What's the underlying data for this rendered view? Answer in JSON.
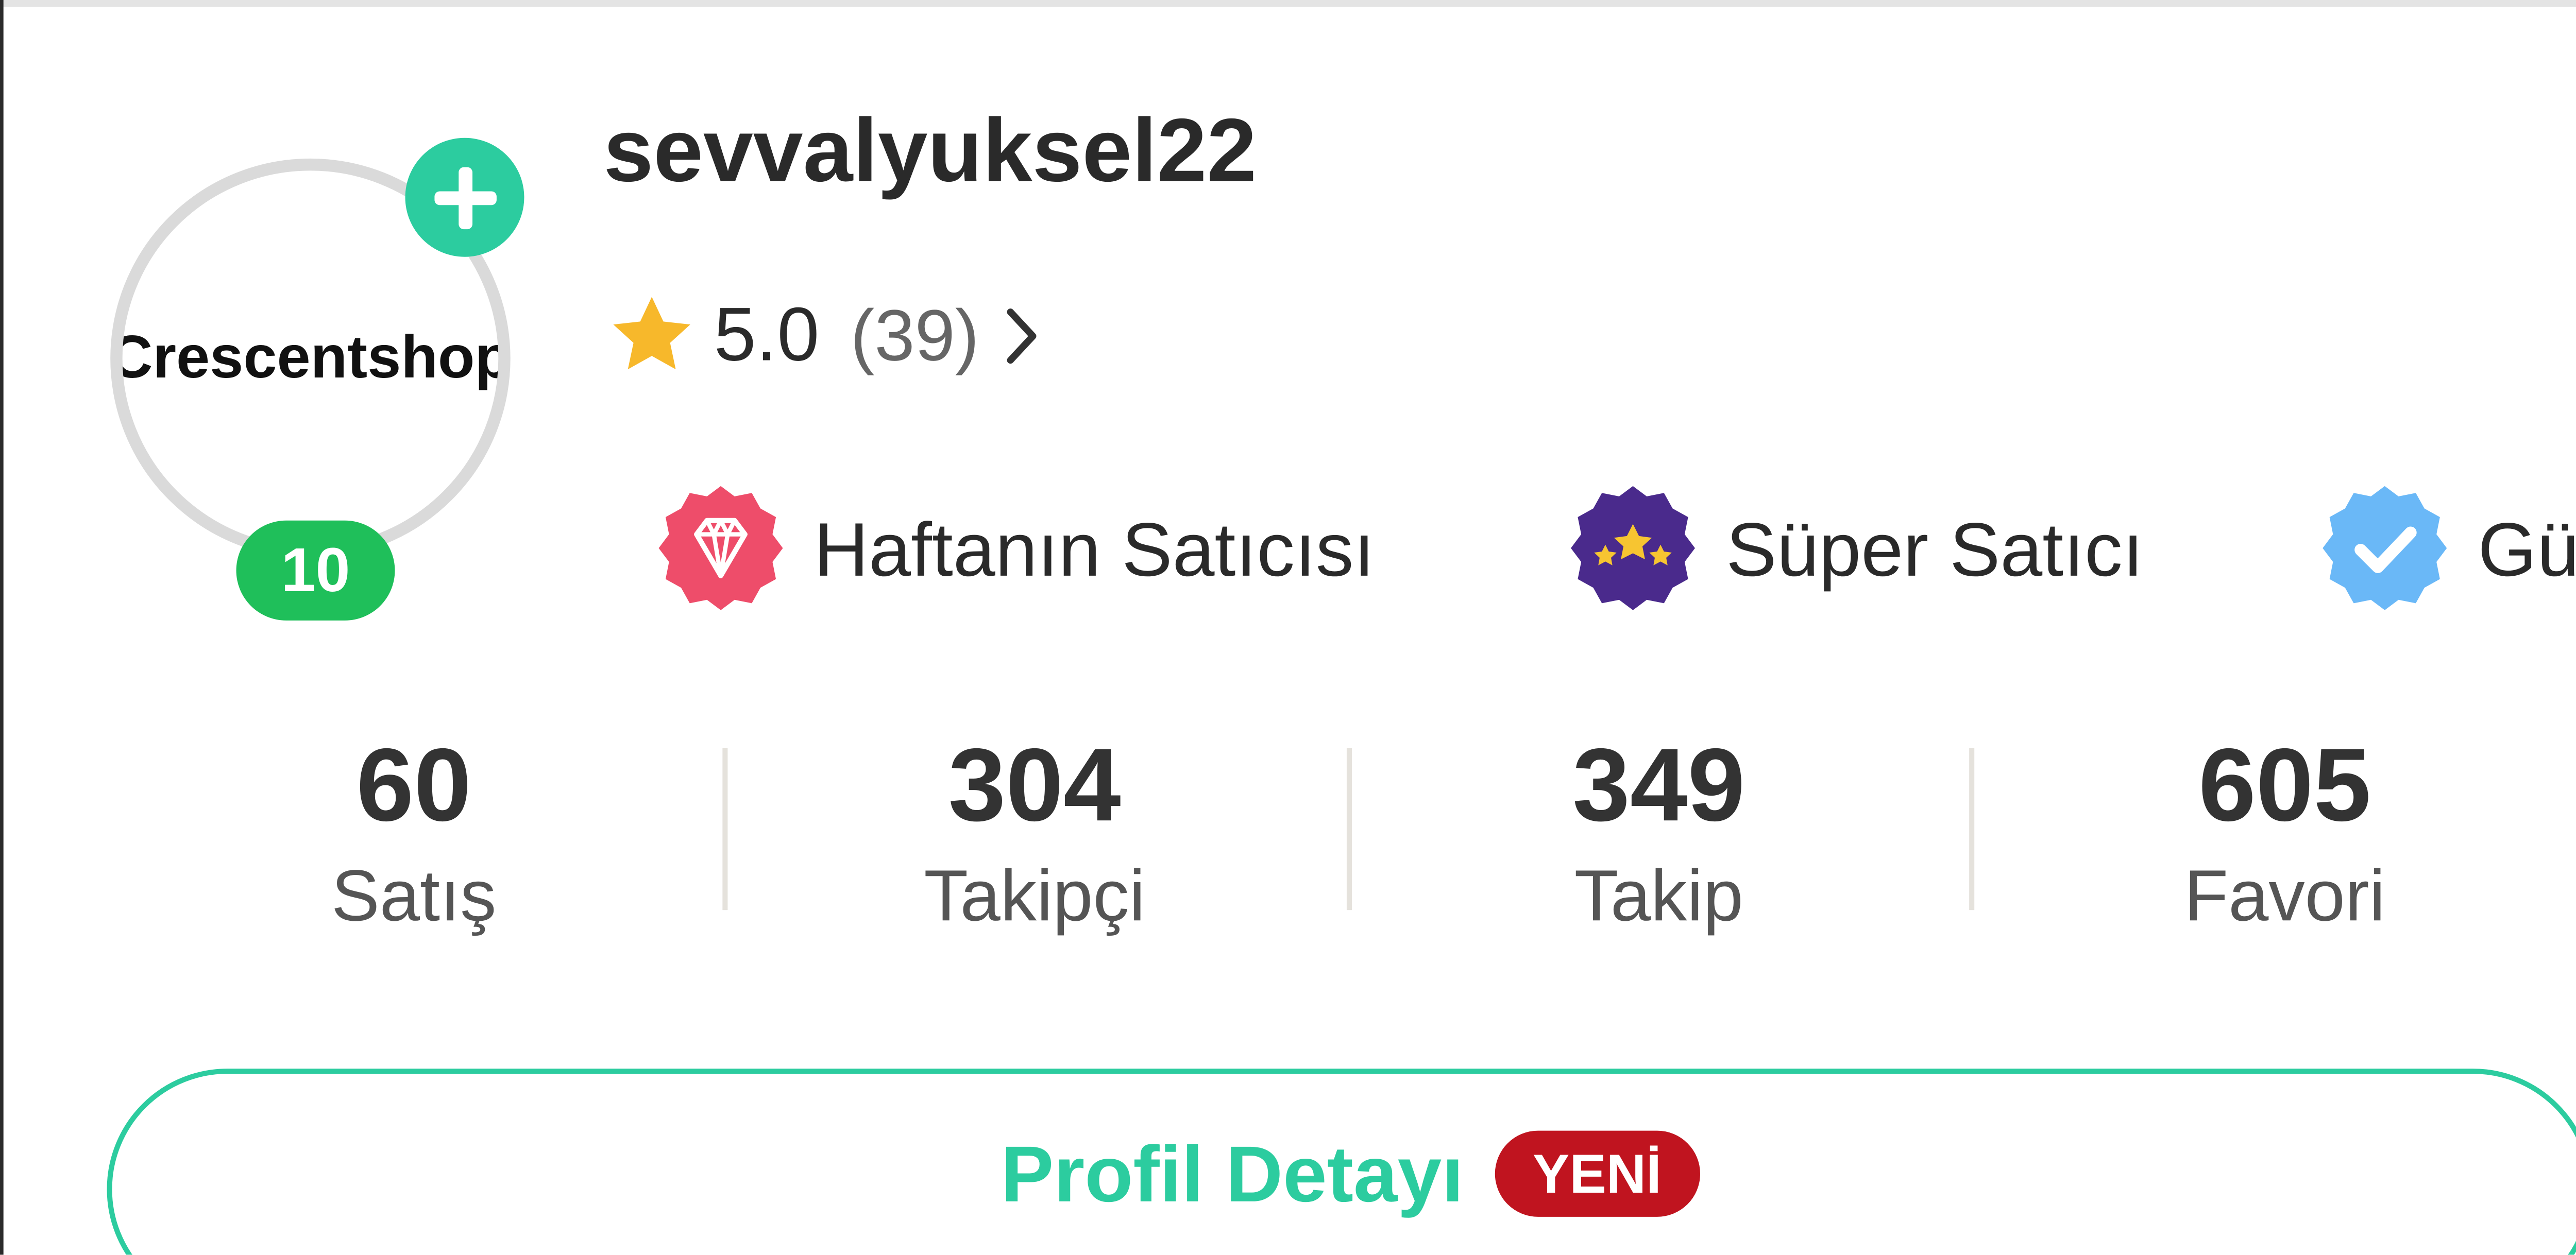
{
  "shop": {
    "avatar_text": "Crescentshop",
    "level": "10",
    "username": "sevvalyuksel22"
  },
  "rating": {
    "score": "5.0",
    "count": "(39)"
  },
  "badges": [
    {
      "label": "Haftanın Satıcısı",
      "icon": "diamond-badge-icon",
      "color": "#ee4d6a"
    },
    {
      "label": "Süper Satıcı",
      "icon": "stars-badge-icon",
      "color": "#4a2a8c"
    },
    {
      "label": "Güven",
      "icon": "verified-badge-icon",
      "color": "#6ab8f7"
    }
  ],
  "stats": [
    {
      "value": "60",
      "label": "Satış"
    },
    {
      "value": "304",
      "label": "Takipçi"
    },
    {
      "value": "349",
      "label": "Takip"
    },
    {
      "value": "605",
      "label": "Favori"
    }
  ],
  "detail_button": {
    "label": "Profil Detayı",
    "badge": "YENİ"
  },
  "colors": {
    "accent": "#2ccc9f",
    "level_badge": "#1fbf5a",
    "new_badge": "#c0141f",
    "star": "#f7b82b"
  }
}
